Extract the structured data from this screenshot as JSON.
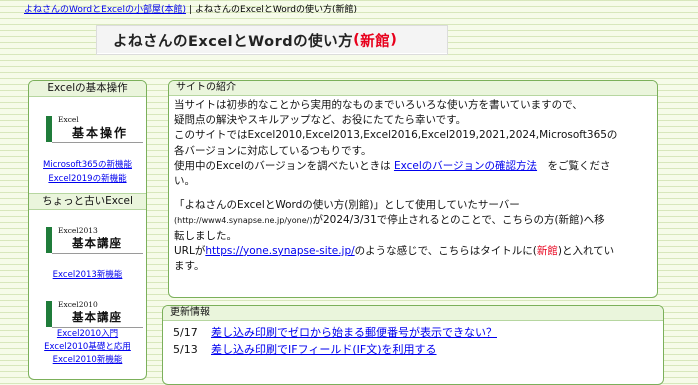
{
  "breadcrumb": {
    "link": "よねさんのWordとExcelの小部屋(本館)",
    "separator": "|",
    "current": "よねさんのExcelとWordの使い方(新館)"
  },
  "page_title": {
    "main": "よねさんのExcelとWordの使い方",
    "suffix_open": "(",
    "suffix": "新館",
    "suffix_close": ")"
  },
  "sidebar": {
    "section1_title": "Excelの基本操作",
    "banner1_small": "Excel",
    "banner1_big": "基本操作",
    "links1": [
      "Microsoft365の新機能",
      "Excel2019の新機能"
    ],
    "section2_title": "ちょっと古いExcel",
    "banner2_small": "Excel2013",
    "banner2_big": "基本講座",
    "links2": [
      "Excel2013新機能"
    ],
    "banner3_small": "Excel2010",
    "banner3_big": "基本講座",
    "links3": [
      "Excel2010入門",
      "Excel2010基礎と応用",
      "Excel2010新機能"
    ]
  },
  "intro": {
    "title": "サイトの紹介",
    "p1_line1": "当サイトは初歩的なことから実用的なものまでいろいろな使い方を書いていますので、",
    "p1_line2": "疑問点の解決やスキルアップなど、お役にたてたら幸いです。",
    "p1_line3": "このサイトではExcel2010,Excel2013,Excel2016,Excel2019,2021,2024,Microsoft365の",
    "p1_line4": "各バージョンに対応しているつもりです。",
    "p1_line5_before": "使用中のExcelのバージョンを調べたいときは ",
    "p1_line5_link": "Excelのバージョンの確認方法",
    "p1_line5_after": "　をご覧くださ",
    "p1_line6": "い。",
    "p2_line1": "「よねさんのExcelとWordの使い方(別館)」として使用していたサーバー",
    "p2_line2_small": "(http://www4.synapse.ne.jp/yone/)",
    "p2_line2_rest": "が2024/3/31で停止されるとのことで、こちらの方(新館)へ移",
    "p2_line3": "転しました。",
    "p2_line4_before": "URLが",
    "p2_line4_link": "https://yone.synapse-site.jp/",
    "p2_line4_mid": "のような感じで、こちらはタイトルに(",
    "p2_line4_red": "新館",
    "p2_line4_after": ")と入れてい",
    "p2_line5": "ます。"
  },
  "news": {
    "title": "更新情報",
    "items": [
      {
        "date": "5/17",
        "text": "差し込み印刷でゼロから始まる郵便番号が表示できない？"
      },
      {
        "date": "5/13",
        "text": "差し込み印刷でIFフィールド(IF文)を利用する"
      }
    ]
  }
}
